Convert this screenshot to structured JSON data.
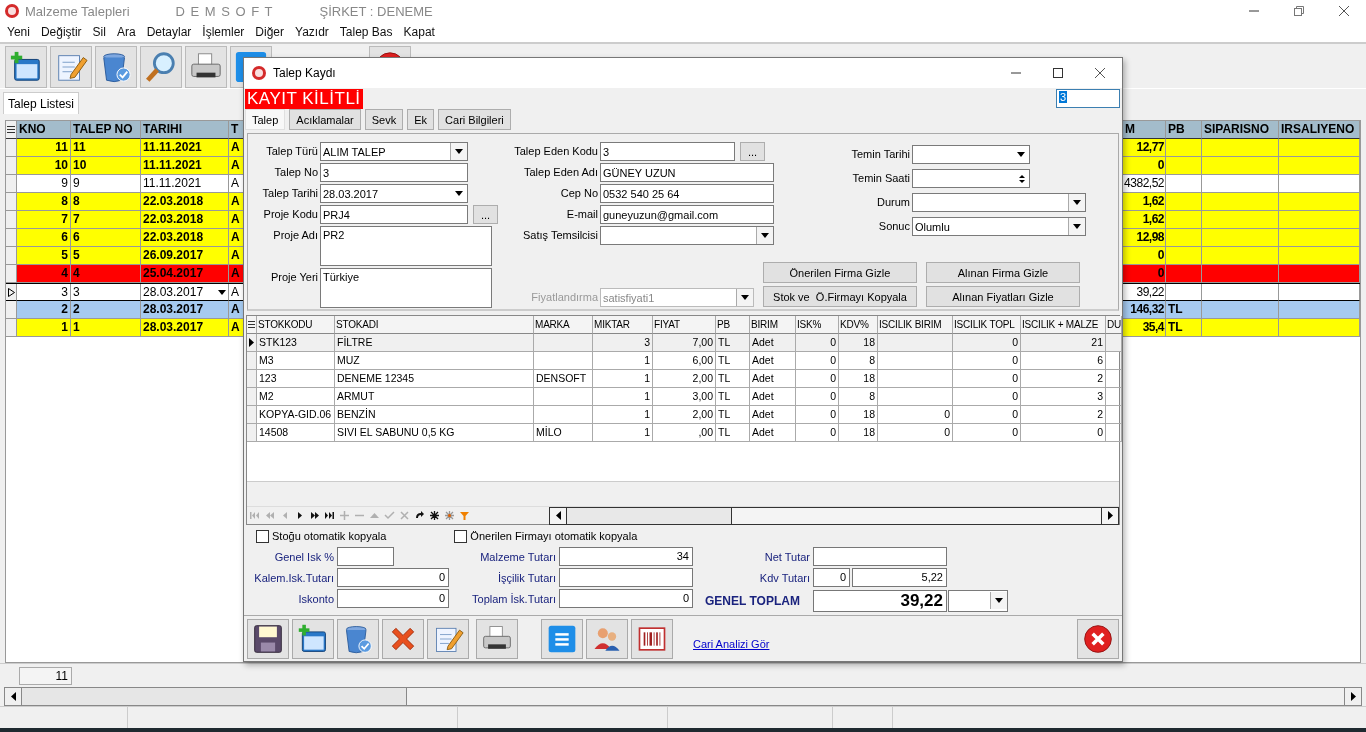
{
  "window": {
    "title": "Malzeme Talepleri",
    "brand": "D E M S O F T",
    "company": "ŞİRKET : DENEME"
  },
  "menu": [
    "Yeni",
    "Değiştir",
    "Sil",
    "Ara",
    "Detaylar",
    "İşlemler",
    "Diğer",
    "Yazıdr",
    "Talep Bas",
    "Kapat"
  ],
  "tabs": [
    {
      "label": "Talep Listesi",
      "selected": true
    }
  ],
  "list": {
    "columns": [
      "KNO",
      "TALEP NO",
      "TARIHI",
      "T",
      "M",
      "PB",
      "SIPARISNO",
      "IRSALIYENO"
    ],
    "rows": [
      {
        "cells": [
          "11",
          "11",
          "11.11.2021",
          "A",
          "12,77"
        ],
        "color": "#ffff00",
        "bold": true,
        "selected": false
      },
      {
        "cells": [
          "10",
          "10",
          "11.11.2021",
          "A",
          "0"
        ],
        "color": "#ffff00",
        "bold": true,
        "selected": false
      },
      {
        "cells": [
          "9",
          "9",
          "11.11.2021",
          "A",
          "4382,52"
        ],
        "color": "#ffffff",
        "bold": false,
        "selected": false
      },
      {
        "cells": [
          "8",
          "8",
          "22.03.2018",
          "A",
          "1,62"
        ],
        "color": "#ffff00",
        "bold": true,
        "selected": false
      },
      {
        "cells": [
          "7",
          "7",
          "22.03.2018",
          "A",
          "1,62"
        ],
        "color": "#ffff00",
        "bold": true,
        "selected": false
      },
      {
        "cells": [
          "6",
          "6",
          "22.03.2018",
          "A",
          "12,98"
        ],
        "color": "#ffff00",
        "bold": true,
        "selected": false
      },
      {
        "cells": [
          "5",
          "5",
          "26.09.2017",
          "A",
          "0"
        ],
        "color": "#ffff00",
        "bold": true,
        "selected": false
      },
      {
        "cells": [
          "4",
          "4",
          "25.04.2017",
          "A",
          "0"
        ],
        "color": "#ff0000",
        "bold": true,
        "selected": false
      },
      {
        "cells": [
          "3",
          "3",
          "28.03.2017",
          "A",
          "39,22"
        ],
        "color": "#ffffff",
        "bold": false,
        "selected": true
      },
      {
        "cells": [
          "2",
          "2",
          "28.03.2017",
          "A",
          "146,32",
          "TL"
        ],
        "color": "#a6caf0",
        "bold": true,
        "selected": false
      },
      {
        "cells": [
          "1",
          "1",
          "28.03.2017",
          "A",
          "35,4",
          "TL"
        ],
        "color": "#ffff00",
        "bold": true,
        "selected": false
      }
    ],
    "record_count": "11"
  },
  "dialog": {
    "title": "Talep Kaydı",
    "lock_label": "KAYIT KİLİTLİ",
    "record_field": "3",
    "tabs": [
      {
        "label": "Talep",
        "selected": true
      },
      {
        "label": "Acıklamalar",
        "selected": false
      },
      {
        "label": "Sevk",
        "selected": false
      },
      {
        "label": "Ek",
        "selected": false
      },
      {
        "label": "Cari Bilgileri",
        "selected": false
      }
    ],
    "form_1": [
      {
        "label": "Talep Türü",
        "value": "ALIM TALEP",
        "kind": "dropdown"
      },
      {
        "label": "Talep No",
        "value": "3",
        "kind": "text"
      },
      {
        "label": "Talep Tarihi",
        "value": "28.03.2017",
        "kind": "date"
      },
      {
        "label": "Proje Kodu",
        "value": "PRJ4",
        "kind": "lookup",
        "button": "..."
      },
      {
        "label": "Proje Adı",
        "value": "PR2",
        "kind": "memo"
      },
      {
        "label": "Proje Yeri",
        "value": "Türkiye",
        "kind": "memo"
      }
    ],
    "form_2": [
      {
        "label": "Talep Eden Kodu",
        "value": "3",
        "kind": "lookup",
        "button": "...",
        "disabled": false
      },
      {
        "label": "Talep Eden Adı",
        "value": "GÜNEY UZUN",
        "kind": "text",
        "disabled": false
      },
      {
        "label": "Cep No",
        "value": "0532 540 25 64",
        "kind": "text",
        "disabled": false
      },
      {
        "label": "E-mail",
        "value": "guneyuzun@gmail.com",
        "kind": "text",
        "disabled": false
      },
      {
        "label": "Satış Temsilcisi",
        "kind": "dropdown",
        "disabled": false
      },
      {
        "label": "Fiyatlandırma",
        "value": "satisfiyati1",
        "kind": "dropdown",
        "disabled": true
      }
    ],
    "form_3": [
      {
        "label": "Temin Tarihi",
        "kind": "date"
      },
      {
        "label": "Temin Saati",
        "kind": "spin"
      },
      {
        "label": "Durum",
        "kind": "dropdown"
      },
      {
        "label": "Sonuc",
        "value": "Olumlu",
        "kind": "dropdown"
      }
    ],
    "buttons": [
      "Önerilen Firma Gizle",
      "Alınan Firma Gizle",
      "Stok ve  Ö.Firmayı Kopyala",
      "Alınan Fiyatları Gizle"
    ],
    "items": {
      "columns": [
        "STOKKODU",
        "STOKADI",
        "MARKA",
        "MIKTAR",
        "FIYAT",
        "PB",
        "BIRIM",
        "ISK%",
        "KDV%",
        "ISCILIK BIRIM",
        "ISCILIK TOPL",
        "ISCILIK + MALZE",
        "DU"
      ],
      "rows": [
        {
          "cells": [
            "STK123",
            "FİLTRE",
            null,
            "3",
            "7,00",
            "TL",
            "Adet",
            "0",
            "18",
            null,
            "0",
            "21"
          ],
          "selected": true
        },
        {
          "cells": [
            "M3",
            "MUZ",
            null,
            "1",
            "6,00",
            "TL",
            "Adet",
            "0",
            "8",
            null,
            "0",
            "6"
          ],
          "selected": false
        },
        {
          "cells": [
            "123",
            "DENEME 12345",
            "DENSOFT",
            "1",
            "2,00",
            "TL",
            "Adet",
            "0",
            "18",
            null,
            "0",
            "2"
          ],
          "selected": false
        },
        {
          "cells": [
            "M2",
            "ARMUT",
            null,
            "1",
            "3,00",
            "TL",
            "Adet",
            "0",
            "8",
            null,
            "0",
            "3"
          ],
          "selected": false
        },
        {
          "cells": [
            "KOPYA-GID.06",
            "BENZİN",
            null,
            "1",
            "2,00",
            "TL",
            "Adet",
            "0",
            "18",
            "0",
            "0",
            "2"
          ],
          "selected": false
        },
        {
          "cells": [
            "14508",
            "SIVI EL SABUNU 0,5 KG",
            "MİLO",
            "1",
            ",00",
            "TL",
            "Adet",
            "0",
            "18",
            "0",
            "0",
            "0"
          ],
          "selected": false
        }
      ]
    },
    "options": [
      {
        "label": "Stoğu otomatik kopyala",
        "checked": false
      },
      {
        "label": "Önerilen Firmayı otomatik kopyala",
        "checked": false
      }
    ],
    "totals_1": [
      {
        "label": "Genel Isk %"
      },
      {
        "label": "Kalem.Isk.Tutarı",
        "value": "0"
      },
      {
        "label": "Iskonto",
        "value": "0"
      }
    ],
    "totals_2": [
      {
        "label": "Malzeme Tutarı",
        "value": "34"
      },
      {
        "label": "İşçilik Tutarı"
      },
      {
        "label": "Toplam İsk.Tutarı",
        "value": "0"
      }
    ],
    "net": {
      "label": "Net Tutar"
    },
    "kdv": {
      "label": "Kdv Tutarı",
      "rate": "0",
      "value": "5,22"
    },
    "grand_total": {
      "label": "GENEL TOPLAM",
      "value": "39,22"
    },
    "link": "Cari Analizi Gör"
  }
}
